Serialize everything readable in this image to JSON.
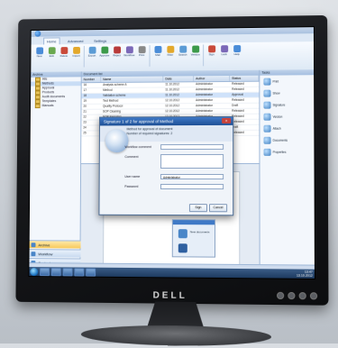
{
  "ribbon": {
    "tabs": [
      "Home",
      "Advanced",
      "Settings"
    ],
    "buttons": [
      {
        "label": "New",
        "color": "#4a8cd8"
      },
      {
        "label": "Edit",
        "color": "#6aa84f"
      },
      {
        "label": "Delete",
        "color": "#c94a3a"
      },
      {
        "label": "Import",
        "color": "#e3a82b"
      },
      {
        "label": "Export",
        "color": "#5b9bd5"
      },
      {
        "label": "Approve",
        "color": "#3c9a4a"
      },
      {
        "label": "Reject",
        "color": "#b83a3a"
      },
      {
        "label": "Workflow",
        "color": "#7b68b8"
      },
      {
        "label": "Print",
        "color": "#888888"
      },
      {
        "label": "Mail",
        "color": "#4a8cd8"
      },
      {
        "label": "Filter",
        "color": "#e3a82b"
      },
      {
        "label": "Search",
        "color": "#5b9bd5"
      },
      {
        "label": "Version",
        "color": "#3c9a4a"
      },
      {
        "label": "Sign",
        "color": "#c94a3a"
      },
      {
        "label": "Lock",
        "color": "#7b68b8"
      },
      {
        "label": "Help",
        "color": "#4a8cd8"
      }
    ]
  },
  "left_panel": {
    "header": "Archive",
    "tree": [
      "Alls",
      "Methods",
      "Approval",
      "Products",
      "Audit documents",
      "Templates",
      "Manuals"
    ],
    "nav": [
      "Archive",
      "Workflow",
      "Contacts",
      "Reports"
    ]
  },
  "grid": {
    "header_label": "Document list",
    "columns": [
      "Number",
      "Name",
      "Date",
      "Author",
      "Status"
    ],
    "rows": [
      [
        "16",
        "Analysis scheme A",
        "11.10.2012",
        "Administrator",
        "Released"
      ],
      [
        "17",
        "Method",
        "11.10.2012",
        "Administrator",
        "Released"
      ],
      [
        "18",
        "Validation scheme",
        "11.10.2012",
        "Administrator",
        "Approval"
      ],
      [
        "19",
        "Test Method",
        "12.10.2012",
        "Administrator",
        "Released"
      ],
      [
        "20",
        "Quality Protocol",
        "12.10.2012",
        "Administrator",
        "Draft"
      ],
      [
        "21",
        "SOP Cleaning",
        "12.10.2012",
        "Administrator",
        "Released"
      ],
      [
        "22",
        "SOP Sampling",
        "12.10.2012",
        "Administrator",
        "Released"
      ],
      [
        "23",
        "Specification",
        "13.10.2012",
        "Administrator",
        "Released"
      ],
      [
        "24",
        "Certificate",
        "13.10.2012",
        "Administrator",
        "Draft"
      ],
      [
        "25",
        "Test report",
        "13.10.2012",
        "Administrator",
        "Released"
      ]
    ],
    "selected_row": 2
  },
  "right_panel": {
    "header": "Tasks",
    "tools": [
      "Print",
      "Show",
      "Signature",
      "Version",
      "Attach",
      "Documents",
      "Properties"
    ]
  },
  "dialog": {
    "title": "Signature 1 of 2 for approval of Method",
    "head_line1": "Method for approval of document",
    "head_line2": "Number of required signatures: 2",
    "fields": [
      {
        "label": "Workflow comment",
        "value": ""
      },
      {
        "label": "Comment",
        "value": ""
      },
      {
        "label": "User name",
        "value": "Administrator"
      },
      {
        "label": "Password",
        "value": ""
      }
    ],
    "ok_label": "Sign",
    "cancel_label": "Cancel",
    "close_label": "x"
  },
  "notification": {
    "text": "New documents"
  },
  "tray": {
    "time": "13:47",
    "date": "13.10.2012"
  },
  "monitor": {
    "brand": "DELL"
  }
}
